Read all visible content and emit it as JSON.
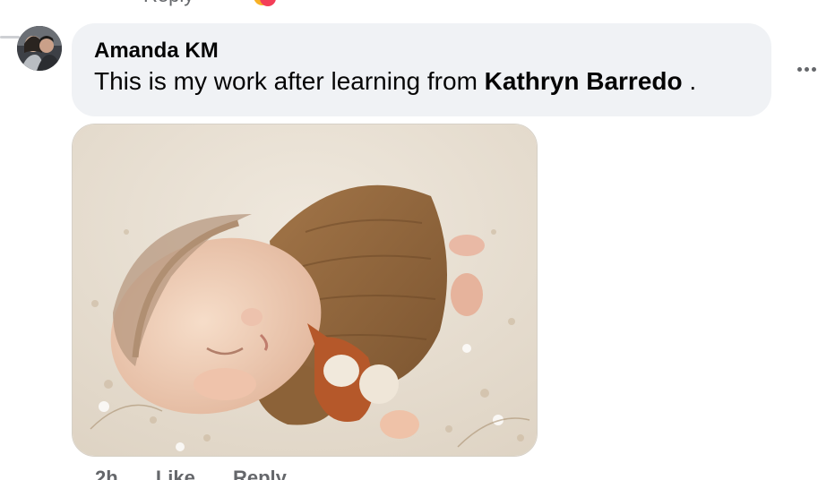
{
  "comment": {
    "author": "Amanda KM",
    "text_prefix": "This is my work after learning from",
    "mention": "Kathryn Barredo",
    "text_suffix": " ."
  },
  "actions": {
    "time": "2h",
    "like_label": "Like",
    "reply_label": "Reply"
  },
  "icons": {
    "more": "more-horizontal-icon",
    "reaction": "reaction-icon"
  },
  "colors": {
    "bubble_bg": "#f0f2f5",
    "secondary_text": "#65676b",
    "primary_text": "#050505"
  }
}
